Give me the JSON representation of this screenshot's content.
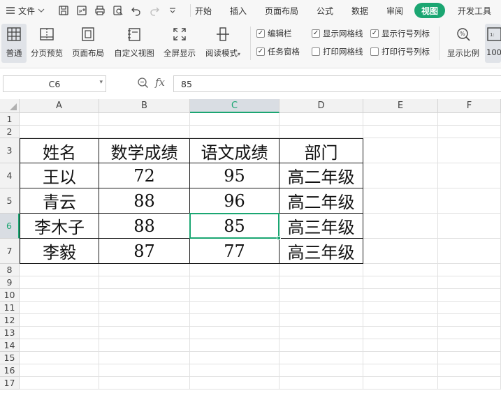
{
  "menu": {
    "file_label": "文件",
    "tabs": [
      {
        "label": "开始",
        "active": false
      },
      {
        "label": "插入",
        "active": false
      },
      {
        "label": "页面布局",
        "active": false
      },
      {
        "label": "公式",
        "active": false
      },
      {
        "label": "数据",
        "active": false
      },
      {
        "label": "审阅",
        "active": false
      },
      {
        "label": "视图",
        "active": true
      },
      {
        "label": "开发工具",
        "active": false
      }
    ],
    "quick_access_icons": [
      "save-icon",
      "export-pdf-icon",
      "print-icon",
      "print-preview-icon",
      "undo-icon",
      "redo-icon",
      "customize-dropdown-icon"
    ]
  },
  "ribbon": {
    "buttons": [
      {
        "label": "普通",
        "icon": "normal-view-icon",
        "selected": true
      },
      {
        "label": "分页预览",
        "icon": "page-break-preview-icon",
        "selected": false
      },
      {
        "label": "页面布局",
        "icon": "page-layout-icon",
        "selected": false
      },
      {
        "label": "自定义视图",
        "icon": "custom-view-icon",
        "selected": false
      },
      {
        "label": "全屏显示",
        "icon": "fullscreen-icon",
        "selected": false
      },
      {
        "label": "阅读模式",
        "icon": "reading-mode-icon",
        "selected": false
      }
    ],
    "checkboxes": [
      {
        "label": "编辑栏",
        "checked": true
      },
      {
        "label": "显示网格线",
        "checked": true
      },
      {
        "label": "显示行号列标",
        "checked": true
      },
      {
        "label": "任务窗格",
        "checked": true
      },
      {
        "label": "打印网格线",
        "checked": false
      },
      {
        "label": "打印行号列标",
        "checked": false
      }
    ],
    "zoom_button": {
      "label": "显示比例",
      "icon": "zoom-ratio-icon"
    },
    "zoom_100_label": "100"
  },
  "formula_bar": {
    "name_box": "C6",
    "fx_symbol": "fx",
    "value": "85"
  },
  "sheet": {
    "columns": [
      "A",
      "B",
      "C",
      "D",
      "E",
      "F"
    ],
    "active_column": "C",
    "rows": [
      "1",
      "2",
      "3",
      "4",
      "5",
      "6",
      "7",
      "8",
      "9",
      "10",
      "11",
      "12",
      "13",
      "14",
      "15",
      "16",
      "17"
    ],
    "active_row": "6",
    "table": {
      "header": [
        "姓名",
        "数学成绩",
        "语文成绩",
        "部门"
      ],
      "records": [
        [
          "王以",
          "72",
          "95",
          "高二年级"
        ],
        [
          "青云",
          "88",
          "96",
          "高二年级"
        ],
        [
          "李木子",
          "88",
          "85",
          "高三年级"
        ],
        [
          "李毅",
          "87",
          "77",
          "高三年级"
        ]
      ]
    }
  },
  "colors": {
    "accent": "#1ba672",
    "toolbar_bg": "#f7f7f7"
  }
}
